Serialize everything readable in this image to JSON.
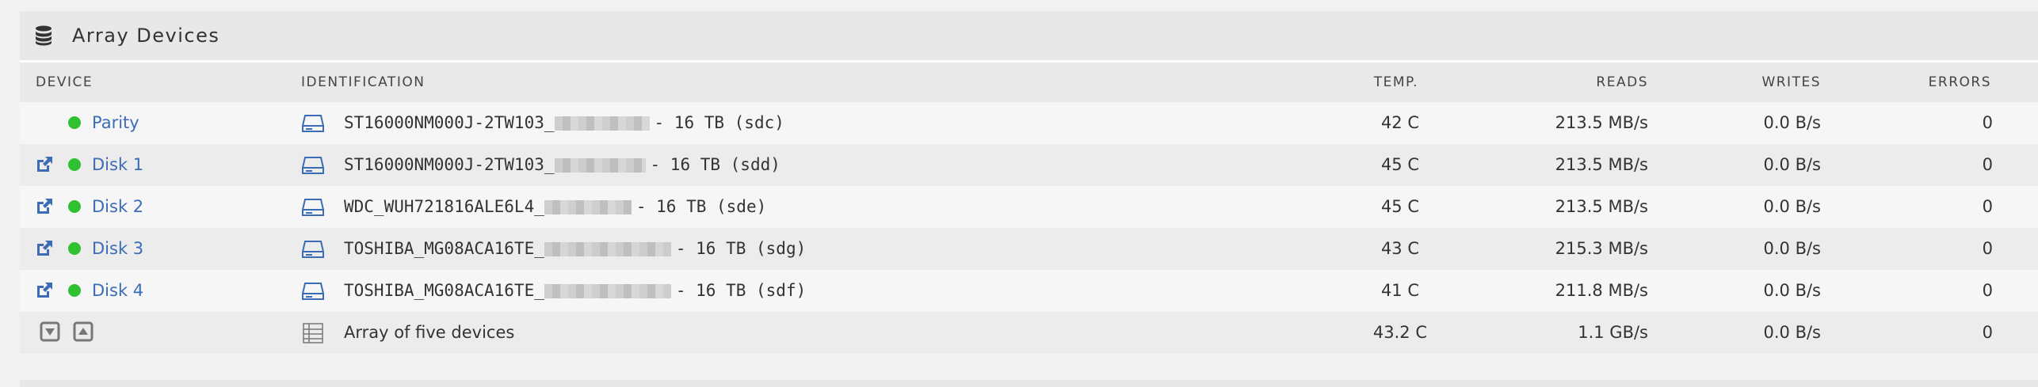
{
  "panel": {
    "title": "Array Devices",
    "icon": "database-icon"
  },
  "columns": {
    "device": "DEVICE",
    "identification": "IDENTIFICATION",
    "temp": "TEMP.",
    "reads": "READS",
    "writes": "WRITES",
    "errors": "ERRORS"
  },
  "rows": [
    {
      "name": "Parity",
      "id_prefix": "ST16000NM000J-2TW103_",
      "id_suffix": "- 16 TB (sdc)",
      "temp": "42 C",
      "reads": "213.5 MB/s",
      "writes": "0.0 B/s",
      "errors": "0"
    },
    {
      "name": "Disk 1",
      "id_prefix": "ST16000NM000J-2TW103_",
      "id_suffix": "- 16 TB (sdd)",
      "temp": "45 C",
      "reads": "213.5 MB/s",
      "writes": "0.0 B/s",
      "errors": "0"
    },
    {
      "name": "Disk 2",
      "id_prefix": "WDC_WUH721816ALE6L4_",
      "id_suffix": "- 16 TB (sde)",
      "temp": "45 C",
      "reads": "213.5 MB/s",
      "writes": "0.0 B/s",
      "errors": "0"
    },
    {
      "name": "Disk 3",
      "id_prefix": "TOSHIBA_MG08ACA16TE_",
      "id_suffix": "- 16 TB (sdg)",
      "temp": "43 C",
      "reads": "215.3 MB/s",
      "writes": "0.0 B/s",
      "errors": "0"
    },
    {
      "name": "Disk 4",
      "id_prefix": "TOSHIBA_MG08ACA16TE_",
      "id_suffix": "- 16 TB (sdf)",
      "temp": "41 C",
      "reads": "211.8 MB/s",
      "writes": "0.0 B/s",
      "errors": "0"
    }
  ],
  "footer": {
    "identification": "Array of five devices",
    "temp": "43.2 C",
    "reads": "1.1 GB/s",
    "writes": "0.0 B/s",
    "errors": "0"
  },
  "colors": {
    "status_ok": "#2fc12f",
    "link": "#3b6cb5"
  }
}
